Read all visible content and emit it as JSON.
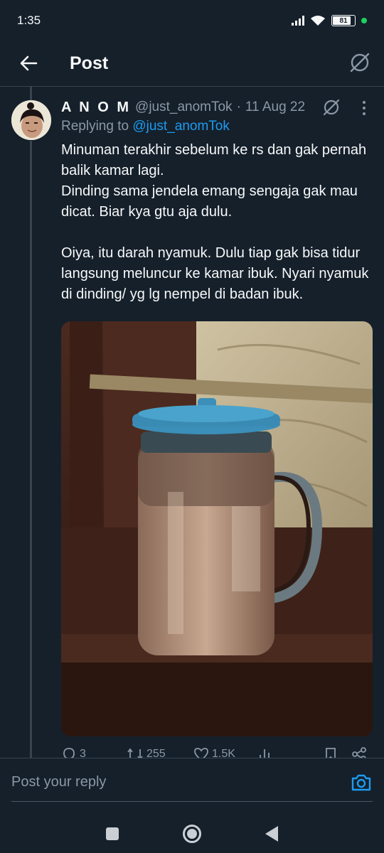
{
  "status_bar": {
    "time": "1:35",
    "battery": "81"
  },
  "header": {
    "title": "Post"
  },
  "tweet": {
    "display_name": "A N O M",
    "handle": "@just_anomTok",
    "separator": "·",
    "date": "11 Aug 22",
    "replying_prefix": "Replying to ",
    "replying_to": "@just_anomTok",
    "text": "Minuman terakhir sebelum ke rs dan gak pernah balik kamar lagi.\nDinding sama jendela emang sengaja gak mau dicat. Biar kya gtu aja dulu.\n\nOiya, itu darah nyamuk. Dulu tiap gak bisa tidur langsung meluncur ke kamar ibuk. Nyari nyamuk di dinding/ yg lg nempel di badan ibuk.",
    "stats": {
      "replies": "3",
      "reposts": "255",
      "likes": "1.5K"
    }
  },
  "reply_bar": {
    "placeholder": "Post your reply"
  },
  "colors": {
    "background": "#15202b",
    "accent": "#1d9bf0",
    "muted": "#8b98a5",
    "divider": "#38444d"
  }
}
